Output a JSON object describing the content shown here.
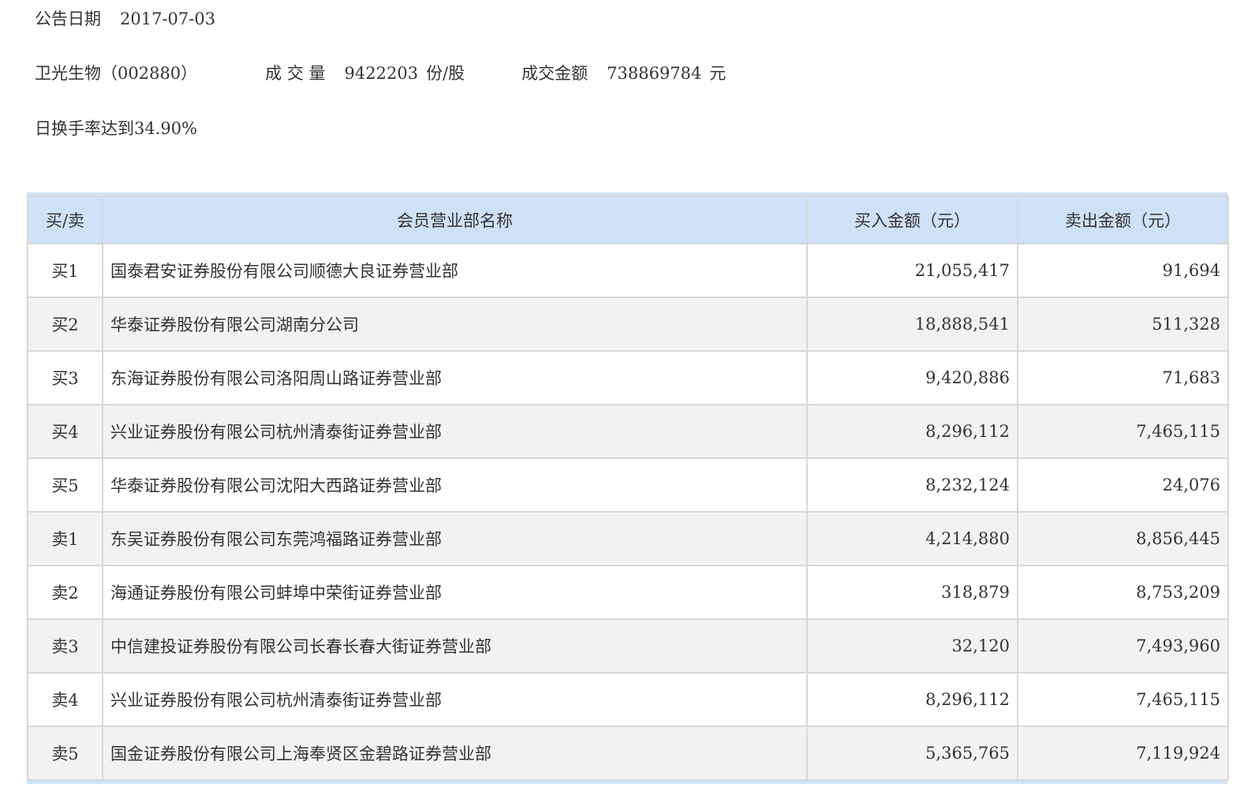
{
  "announce": {
    "date_label": "公告日期",
    "date_value": "2017-07-03"
  },
  "stock": {
    "name": "卫光生物（002880）",
    "volume_label": "成 交 量",
    "volume_value": "9422203",
    "volume_unit": "份/股",
    "amount_label": "成交金额",
    "amount_value": "738869784",
    "amount_unit": "元"
  },
  "reason": "日换手率达到34.90%",
  "table": {
    "headers": [
      "买/卖",
      "会员营业部名称",
      "买入金额（元）",
      "卖出金额（元）"
    ],
    "rows": [
      {
        "side": "买1",
        "name": "国泰君安证券股份有限公司顺德大良证券营业部",
        "buy": "21,055,417",
        "sell": "91,694"
      },
      {
        "side": "买2",
        "name": "华泰证券股份有限公司湖南分公司",
        "buy": "18,888,541",
        "sell": "511,328"
      },
      {
        "side": "买3",
        "name": "东海证券股份有限公司洛阳周山路证券营业部",
        "buy": "9,420,886",
        "sell": "71,683"
      },
      {
        "side": "买4",
        "name": "兴业证券股份有限公司杭州清泰街证券营业部",
        "buy": "8,296,112",
        "sell": "7,465,115"
      },
      {
        "side": "买5",
        "name": "华泰证券股份有限公司沈阳大西路证券营业部",
        "buy": "8,232,124",
        "sell": "24,076"
      },
      {
        "side": "卖1",
        "name": "东吴证券股份有限公司东莞鸿福路证券营业部",
        "buy": "4,214,880",
        "sell": "8,856,445"
      },
      {
        "side": "卖2",
        "name": "海通证券股份有限公司蚌埠中荣街证券营业部",
        "buy": "318,879",
        "sell": "8,753,209"
      },
      {
        "side": "卖3",
        "name": "中信建投证券股份有限公司长春长春大街证券营业部",
        "buy": "32,120",
        "sell": "7,493,960"
      },
      {
        "side": "卖4",
        "name": "兴业证券股份有限公司杭州清泰街证券营业部",
        "buy": "8,296,112",
        "sell": "7,465,115"
      },
      {
        "side": "卖5",
        "name": "国金证券股份有限公司上海奉贤区金碧路证券营业部",
        "buy": "5,365,765",
        "sell": "7,119,924"
      }
    ]
  },
  "colors": {
    "header_bg": "#cfe1f6",
    "border": "#d8d8d8",
    "stripe": "#f2f2f2",
    "text": "#333333"
  }
}
